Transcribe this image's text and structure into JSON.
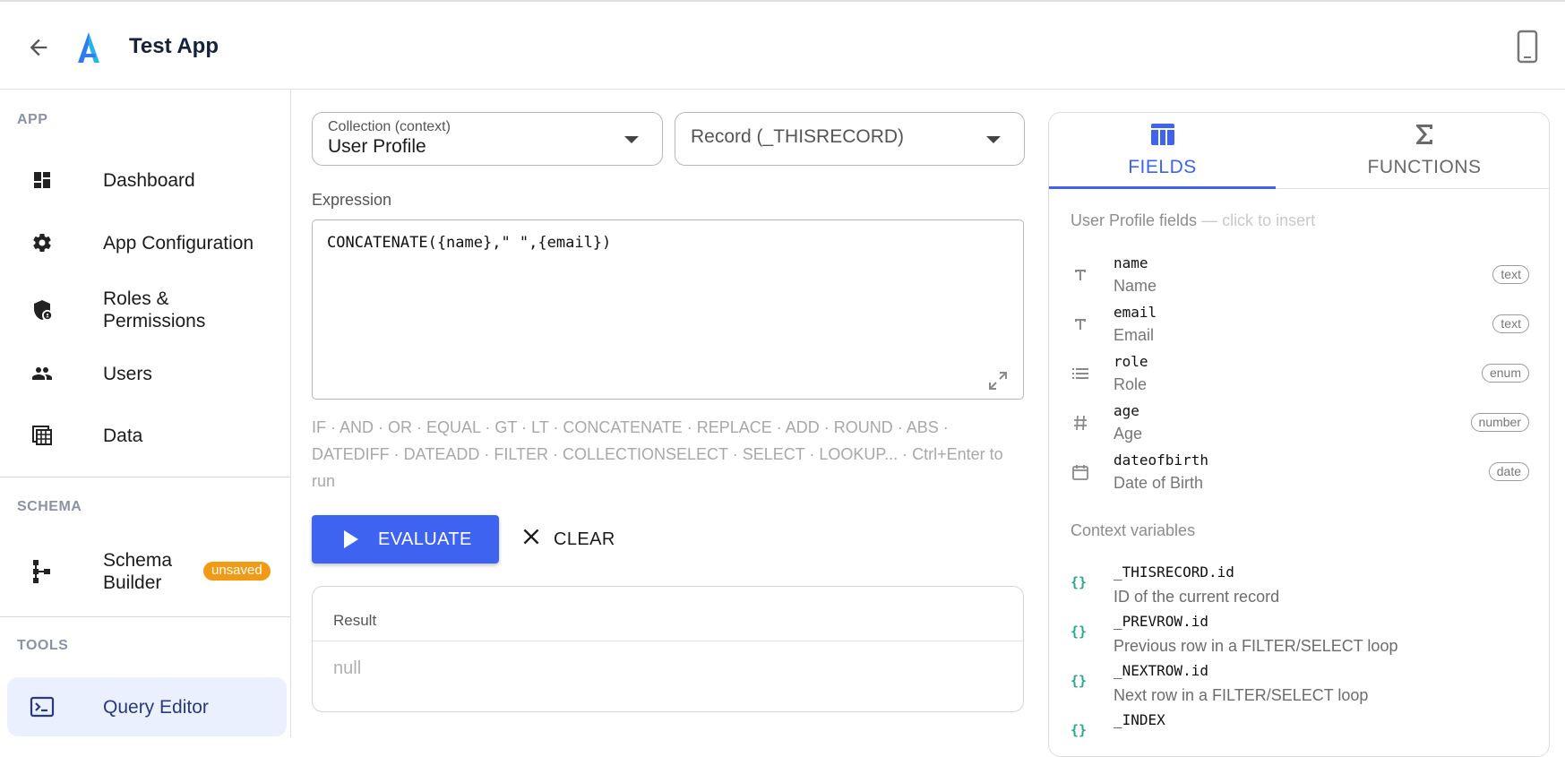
{
  "header": {
    "title": "Test App",
    "back_icon": "arrow-left-icon",
    "device_icon": "smartphone-icon",
    "logo_colors": [
      "#2f7bf0",
      "#27b5e8"
    ]
  },
  "sidebar": {
    "sections": [
      {
        "label": "APP"
      },
      {
        "label": "SCHEMA"
      },
      {
        "label": "TOOLS"
      }
    ],
    "items": [
      {
        "label": "Dashboard",
        "icon": "dashboard-icon"
      },
      {
        "label": "App Configuration",
        "icon": "gear-icon"
      },
      {
        "label": "Roles & Permissions",
        "icon": "shield-lock-icon"
      },
      {
        "label": "Users",
        "icon": "users-icon"
      },
      {
        "label": "Data",
        "icon": "table-icon"
      },
      {
        "label": "Schema Builder",
        "icon": "schema-tree-icon",
        "badge": "unsaved"
      },
      {
        "label": "Query Editor",
        "icon": "terminal-icon",
        "active": true
      }
    ],
    "badge_color": "#f39a14"
  },
  "main": {
    "collection_select": {
      "label": "Collection (context)",
      "value": "User Profile"
    },
    "record_select": {
      "placeholder": "Record (_THISRECORD)"
    },
    "expression_label": "Expression",
    "expression_value": "CONCATENATE({name},\" \",{email})",
    "hint": "IF · AND · OR · EQUAL · GT · LT · CONCATENATE · REPLACE · ADD · ROUND · ABS · DATEDIFF · DATEADD · FILTER · COLLECTIONSELECT · SELECT · LOOKUP... · Ctrl+Enter to run",
    "evaluate_label": "EVALUATE",
    "clear_label": "CLEAR",
    "result_title": "Result",
    "result_value": "null",
    "accent": "#3d63f0"
  },
  "panel": {
    "tabs": [
      {
        "label": "FIELDS",
        "icon": "table-columns-icon",
        "active": true
      },
      {
        "label": "FUNCTIONS",
        "icon": "sigma-icon",
        "active": false
      }
    ],
    "fields_heading": "User Profile fields",
    "fields_hint": "— click to insert",
    "fields": [
      {
        "key": "name",
        "label": "Name",
        "type": "text",
        "icon": "text-type-icon"
      },
      {
        "key": "email",
        "label": "Email",
        "type": "text",
        "icon": "text-type-icon"
      },
      {
        "key": "role",
        "label": "Role",
        "type": "enum",
        "icon": "list-icon"
      },
      {
        "key": "age",
        "label": "Age",
        "type": "number",
        "icon": "hash-icon"
      },
      {
        "key": "dateofbirth",
        "label": "Date of Birth",
        "type": "date",
        "icon": "calendar-icon"
      }
    ],
    "context_heading": "Context variables",
    "context_vars": [
      {
        "key": "_THISRECORD.id",
        "desc": "ID of the current record"
      },
      {
        "key": "_PREVROW.id",
        "desc": "Previous row in a FILTER/SELECT loop"
      },
      {
        "key": "_NEXTROW.id",
        "desc": "Next row in a FILTER/SELECT loop"
      },
      {
        "key": "_INDEX",
        "desc": ""
      }
    ],
    "context_icon_color": "#2aa88c"
  }
}
